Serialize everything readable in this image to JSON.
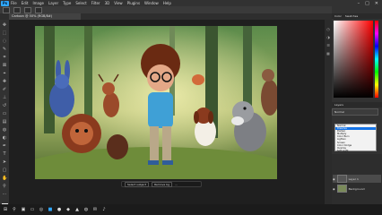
{
  "app": {
    "logo": "Ps",
    "menu": [
      "File",
      "Edit",
      "Image",
      "Layer",
      "Type",
      "Select",
      "Filter",
      "3D",
      "View",
      "Plugins",
      "Window",
      "Help"
    ]
  },
  "document": {
    "tab_title": "Cartoon @ 50% (RGB/8#)"
  },
  "task_bar": {
    "btn1": "Select subject",
    "btn2": "Remove bg"
  },
  "panels": {
    "color_tabs": [
      "Color",
      "Swatches"
    ],
    "properties_title": "Layers",
    "blend_mode": "Normal",
    "blend_options": [
      "Normal",
      "Dissolve",
      "Darken",
      "Multiply",
      "Color Burn",
      "Lighten",
      "Screen",
      "Color Dodge",
      "Overlay",
      "Soft Light"
    ],
    "blend_selected_index": 1,
    "layers": [
      "Layer 1",
      "Background"
    ]
  },
  "colors": {
    "accent": "#31a8ff",
    "selection": "#1473e6"
  }
}
